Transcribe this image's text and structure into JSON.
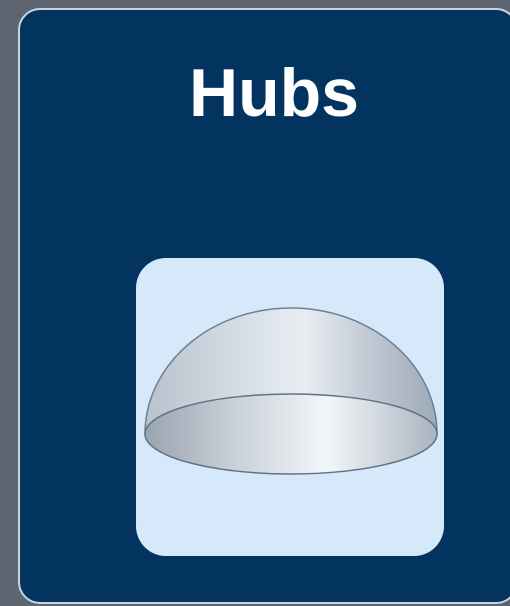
{
  "card": {
    "title": "Hubs",
    "icon": "hemisphere-hub-icon",
    "accent_color": "#033460",
    "tile_color": "#d5e9fb"
  }
}
